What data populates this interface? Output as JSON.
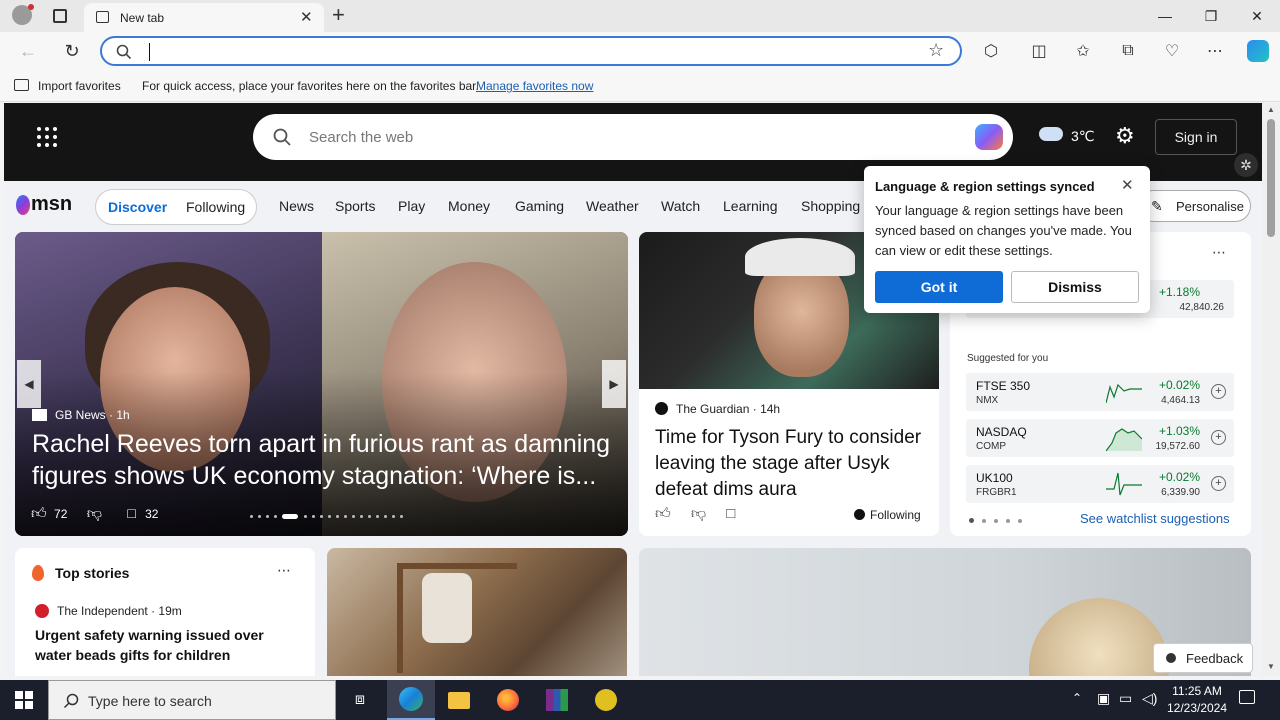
{
  "browser": {
    "tab_title": "New tab",
    "new_tab_symbol": "+",
    "address_value": "",
    "fav_import": "Import favorites",
    "fav_hint": "For quick access, place your favorites here on the favorites bar.",
    "fav_manage": "Manage favorites now"
  },
  "msn": {
    "search_placeholder": "Search the web",
    "weather_temp": "3℃",
    "sign_in": "Sign in",
    "logo": "msn",
    "seg_discover": "Discover",
    "seg_following": "Following",
    "nav": [
      "News",
      "Sports",
      "Play",
      "Money",
      "Gaming",
      "Weather",
      "Watch",
      "Learning",
      "Shopping"
    ],
    "personalise": "Personalise"
  },
  "hero": {
    "source": "GB News",
    "age": "1h",
    "title": "Rachel Reeves torn apart in furious rant as damning figures shows UK economy stagnation: ‘Where is...",
    "likes": "72",
    "comments": "32"
  },
  "article2": {
    "source": "The Guardian",
    "age": "14h",
    "title": "Time for Tyson Fury to consider leaving the stage after Usyk defeat dims aura",
    "following": "Following"
  },
  "popup": {
    "title": "Language & region settings synced",
    "message": "Your language & region settings have been synced based on changes you've made. You can view or edit these settings.",
    "got_it": "Got it",
    "dismiss": "Dismiss"
  },
  "watchlist": {
    "top_change": "+1.18%",
    "top_value": "42,840.26",
    "suggested_label": "Suggested for you",
    "stocks": [
      {
        "name": "FTSE 350",
        "sub": "NMX",
        "change": "+0.02%",
        "value": "4,464.13"
      },
      {
        "name": "NASDAQ",
        "sub": "COMP",
        "change": "+1.03%",
        "value": "19,572.60"
      },
      {
        "name": "UK100",
        "sub": "FRGBR1",
        "change": "+0.02%",
        "value": "6,339.90"
      }
    ],
    "see_suggestions": "See watchlist suggestions"
  },
  "top_stories": {
    "heading": "Top stories",
    "source": "The Independent",
    "age": "19m",
    "title": "Urgent safety warning issued over water beads gifts for children"
  },
  "feedback": "Feedback",
  "taskbar": {
    "search_placeholder": "Type here to search",
    "time": "11:25 AM",
    "date": "12/23/2024"
  },
  "colors": {
    "accent": "#0f6cd6",
    "positive": "#0a7a2f",
    "link": "#1a5fb4"
  }
}
